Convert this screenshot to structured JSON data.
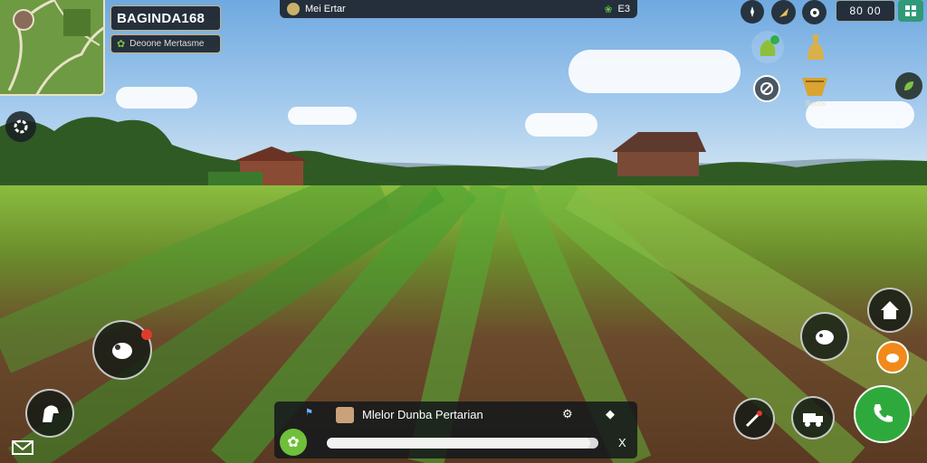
{
  "brand": {
    "title": "BAGINDA168",
    "subtitle": "Deoone Mertasme"
  },
  "top_bar": {
    "label": "Mei Ertar",
    "right_text": "E3"
  },
  "money": {
    "value": "80 00"
  },
  "harvest_label": {
    "text": "Suoos"
  },
  "bottom_panel": {
    "title": "Mlelor Dunba Pertarian",
    "progress_fraction": 0.97,
    "close_glyph": "X"
  },
  "icons": {
    "top_right": [
      "compass-icon",
      "horn-icon",
      "chat-icon",
      "menu-icon"
    ],
    "tools": [
      "seed-bag-icon",
      "fertilizer-bottle-icon",
      "target-icon",
      "harvest-basket-icon",
      "leaf-settings-icon"
    ],
    "left": [
      "settings-icon",
      "animal-icon",
      "horse-icon",
      "mail-icon"
    ],
    "right": [
      "house-icon",
      "cow-icon",
      "food-icon",
      "plant-tool-icon",
      "truck-icon",
      "phone-icon"
    ]
  },
  "colors": {
    "accent": "#e8c25a",
    "phone": "#2eaa3c",
    "badge": "#e03a2a",
    "orange": "#f08a1a"
  }
}
